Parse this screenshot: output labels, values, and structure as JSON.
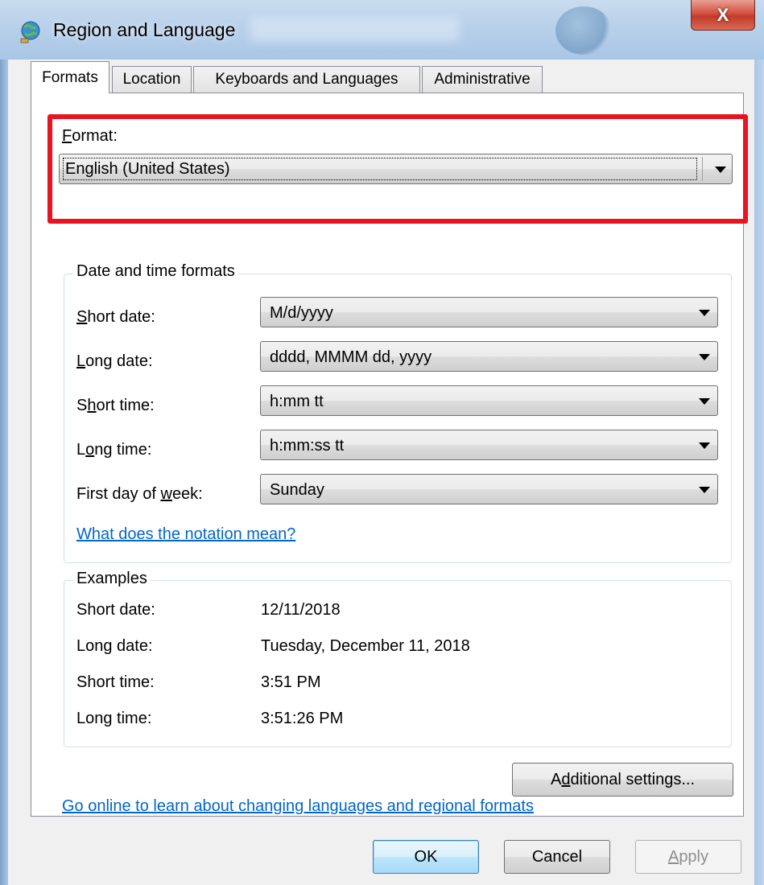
{
  "window": {
    "title": "Region and Language",
    "close_glyph": "X"
  },
  "tabs": [
    {
      "label": "Formats",
      "active": true
    },
    {
      "label": "Location",
      "active": false
    },
    {
      "label": "Keyboards and Languages",
      "active": false
    },
    {
      "label": "Administrative",
      "active": false
    }
  ],
  "format": {
    "label_accel": "F",
    "label_rest": "ormat:",
    "value": "English (United States)"
  },
  "date_time": {
    "group_title": "Date and time formats",
    "rows": [
      {
        "pre": "",
        "accel": "S",
        "post": "hort date:",
        "value": "M/d/yyyy"
      },
      {
        "pre": "",
        "accel": "L",
        "post": "ong date:",
        "value": "dddd, MMMM dd, yyyy"
      },
      {
        "pre": "S",
        "accel": "h",
        "post": "ort time:",
        "value": "h:mm tt"
      },
      {
        "pre": "L",
        "accel": "o",
        "post": "ng time:",
        "value": "h:mm:ss tt"
      },
      {
        "pre": "First day of ",
        "accel": "w",
        "post": "eek:",
        "value": "Sunday"
      }
    ],
    "notation_link": "What does the notation mean?"
  },
  "examples": {
    "group_title": "Examples",
    "rows": [
      {
        "label": "Short date:",
        "value": "12/11/2018"
      },
      {
        "label": "Long date:",
        "value": "Tuesday, December 11, 2018"
      },
      {
        "label": "Short time:",
        "value": "3:51 PM"
      },
      {
        "label": "Long time:",
        "value": "3:51:26 PM"
      }
    ]
  },
  "additional_settings": {
    "pre": "A",
    "accel": "d",
    "post": "ditional settings..."
  },
  "online_link": "Go online to learn about changing languages and regional formats",
  "buttons": {
    "ok": "OK",
    "cancel": "Cancel",
    "apply_accel": "A",
    "apply_rest": "pply"
  },
  "colors": {
    "highlight": "#e8141f",
    "link": "#0066cc",
    "title_gradient": "#b8d0ea"
  },
  "icons": [
    "globe-app-icon",
    "close-icon",
    "chevron-down-icon"
  ]
}
